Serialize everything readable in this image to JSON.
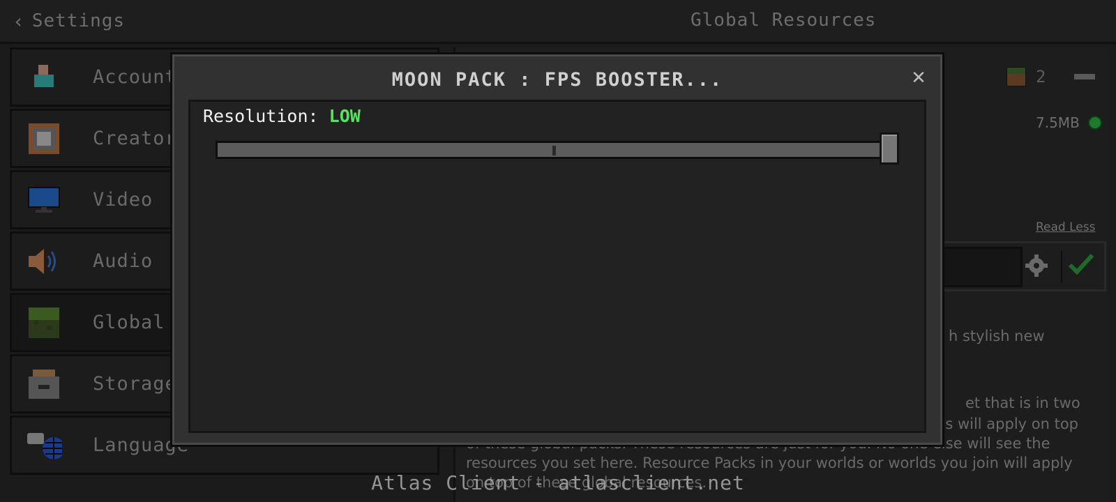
{
  "header": {
    "back_label": "Settings",
    "title": "Global Resources"
  },
  "sidebar": {
    "items": [
      {
        "label": "Account",
        "icon": "account-icon"
      },
      {
        "label": "Creator",
        "icon": "creator-icon"
      },
      {
        "label": "Video",
        "icon": "monitor-icon"
      },
      {
        "label": "Audio",
        "icon": "speaker-icon"
      },
      {
        "label": "Global Re",
        "icon": "grass-block-icon"
      },
      {
        "label": "Storage",
        "icon": "storage-icon"
      },
      {
        "label": "Language",
        "icon": "language-icon"
      }
    ]
  },
  "right_panel": {
    "pack_count": "2",
    "size": "7.5MB",
    "read_less": "Read Less",
    "desc_fragments": [
      "h stylish new",
      "et that is in two",
      "ds will apply on top"
    ],
    "desc_lines": [
      "of these global packs. These resources are just for you. No one else will see the",
      "resources you set here. Resource Packs in your worlds or worlds you join will apply",
      "on top of these global resources."
    ]
  },
  "modal": {
    "title": "MOON PACK : FPS BOOSTER...",
    "setting_label": "Resolution:",
    "setting_value": "LOW",
    "slider_position": 1.0
  },
  "watermark": "Atlas Client - atlasclient.net",
  "colors": {
    "accent_green": "#55e35a",
    "modal_bg": "#313131",
    "status_dot": "#1f7a2e"
  }
}
